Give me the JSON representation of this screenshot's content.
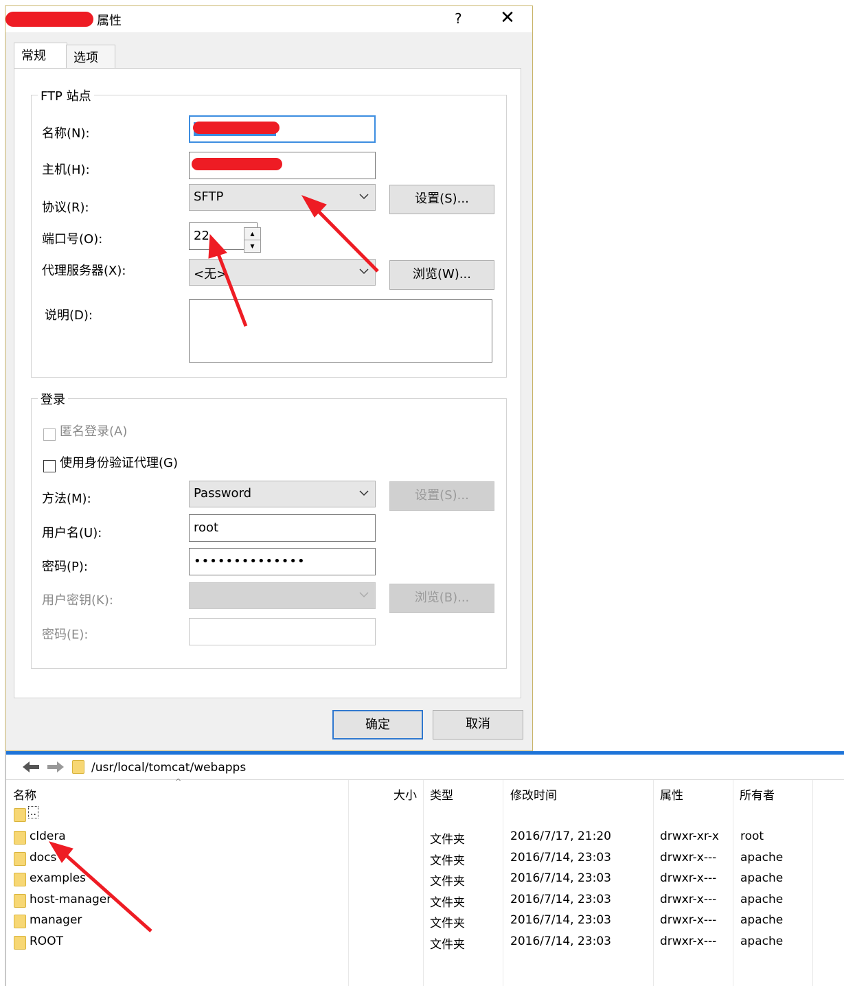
{
  "dialog": {
    "title": "属性",
    "help": "?",
    "close": "✕",
    "tabs": [
      "常规",
      "选项"
    ],
    "ftp_group": {
      "legend": "FTP 站点",
      "name_label": "名称(N):",
      "host_label": "主机(H):",
      "protocol_label": "协议(R):",
      "protocol_value": "SFTP",
      "settings_button": "设置(S)...",
      "port_label": "端口号(O):",
      "port_value": "22",
      "proxy_label": "代理服务器(X):",
      "proxy_value": "<无>",
      "browse_button": "浏览(W)...",
      "desc_label": "说明(D):"
    },
    "login_group": {
      "legend": "登录",
      "anonymous_label": "匿名登录(A)",
      "agent_label": "使用身份验证代理(G)",
      "method_label": "方法(M):",
      "method_value": "Password",
      "method_settings_button": "设置(S)...",
      "user_label": "用户名(U):",
      "user_value": "root",
      "password_label": "密码(P):",
      "password_value": "••••••••••••••",
      "key_label": "用户密钥(K):",
      "key_browse_button": "浏览(B)...",
      "passphrase_label": "密码(E):"
    },
    "ok_button": "确定",
    "cancel_button": "取消"
  },
  "file_pane": {
    "path": "/usr/local/tomcat/webapps",
    "columns": {
      "name": "名称",
      "size": "大小",
      "type": "类型",
      "modified": "修改时间",
      "attributes": "属性",
      "owner": "所有者"
    },
    "parent_dir": "..",
    "rows": [
      {
        "name": "cldera",
        "type": "文件夹",
        "modified": "2016/7/17, 21:20",
        "attributes": "drwxr-xr-x",
        "owner": "root"
      },
      {
        "name": "docs",
        "type": "文件夹",
        "modified": "2016/7/14, 23:03",
        "attributes": "drwxr-x---",
        "owner": "apache"
      },
      {
        "name": "examples",
        "type": "文件夹",
        "modified": "2016/7/14, 23:03",
        "attributes": "drwxr-x---",
        "owner": "apache"
      },
      {
        "name": "host-manager",
        "type": "文件夹",
        "modified": "2016/7/14, 23:03",
        "attributes": "drwxr-x---",
        "owner": "apache"
      },
      {
        "name": "manager",
        "type": "文件夹",
        "modified": "2016/7/14, 23:03",
        "attributes": "drwxr-x---",
        "owner": "apache"
      },
      {
        "name": "ROOT",
        "type": "文件夹",
        "modified": "2016/7/14, 23:03",
        "attributes": "drwxr-x---",
        "owner": "apache"
      }
    ]
  },
  "colors": {
    "annotation_red": "#ee1c24",
    "accent_blue": "#1e74d8",
    "folder_yellow": "#f7d774"
  }
}
